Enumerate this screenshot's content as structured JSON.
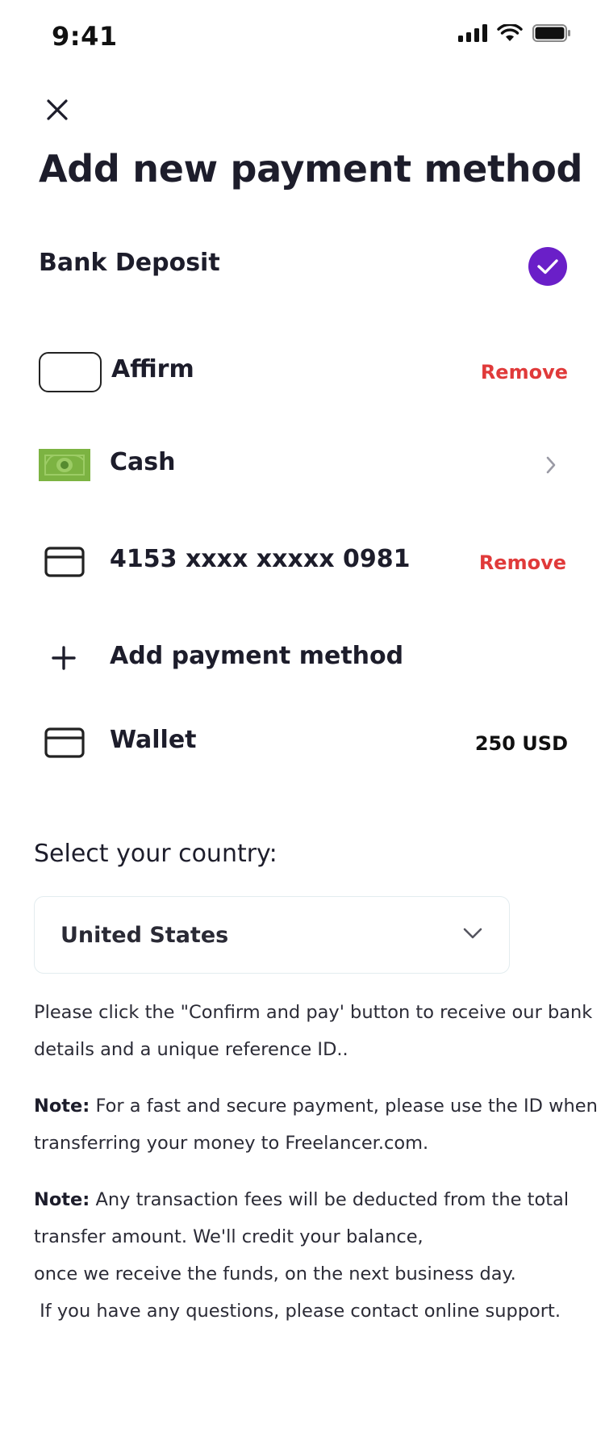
{
  "status_bar": {
    "time": "9:41",
    "icons": [
      "signal-icon",
      "wifi-icon",
      "battery-icon"
    ]
  },
  "header": {
    "close_icon": "close-icon",
    "title": "Add new payment method"
  },
  "methods": {
    "bank": {
      "label": "Bank Deposit",
      "selected": true,
      "check_color": "#6a1fc8"
    },
    "affirm": {
      "label": "Affirm",
      "action": "Remove"
    },
    "cash": {
      "label": "Cash",
      "icon": "banknote-icon",
      "icon_color": "#7cb342"
    },
    "card": {
      "label": "4153 xxxx xxxxx 0981",
      "icon": "credit-card-icon",
      "action": "Remove"
    },
    "add": {
      "label": "Add payment method",
      "icon": "plus-icon"
    },
    "wallet": {
      "label": "Wallet",
      "icon": "credit-card-icon",
      "balance": "250 USD"
    }
  },
  "country": {
    "prompt": "Select your country:",
    "selected": "United States"
  },
  "info": {
    "para1_lines": [
      "Please click the \"Confirm and pay' button to receive our bank",
      "details and a unique reference ID.."
    ],
    "note_label": "Note:",
    "para2_line1": " For a fast and secure payment, please use the ID when",
    "para2_line2": "transferring your money to Freelancer.com.",
    "para3_line1": " Any transaction fees will be deducted from the total",
    "para3_line2": "transfer amount. We'll credit your balance,",
    "para3_line3": "once we receive the funds, on the next business day.",
    "para3_line4": " If you have any questions, please contact online support."
  },
  "colors": {
    "accent": "#6a1fc8",
    "danger": "#e03a3a",
    "text": "#1d1d2b"
  }
}
